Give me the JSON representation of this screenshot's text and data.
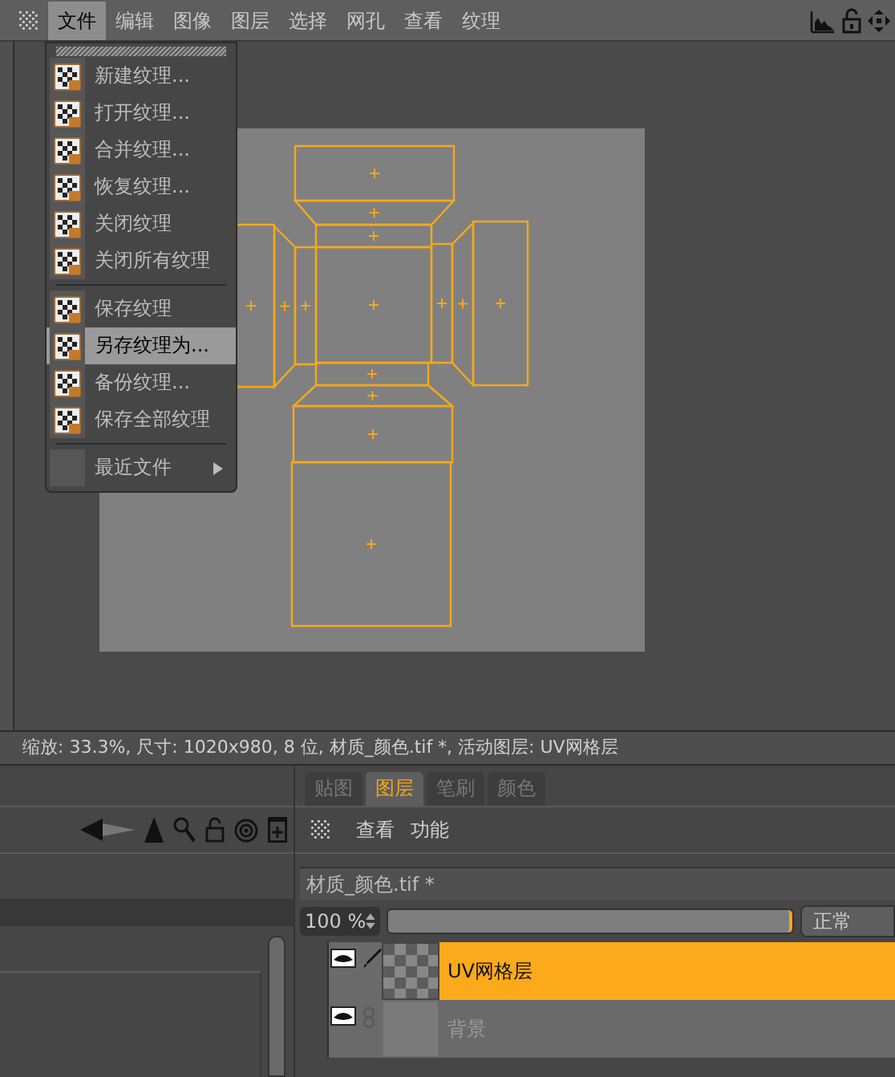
{
  "menubar": {
    "items": [
      {
        "label": "文件",
        "selected": true
      },
      {
        "label": "编辑",
        "selected": false
      },
      {
        "label": "图像",
        "selected": false
      },
      {
        "label": "图层",
        "selected": false
      },
      {
        "label": "选择",
        "selected": false
      },
      {
        "label": "网孔",
        "selected": false
      },
      {
        "label": "查看",
        "selected": false
      },
      {
        "label": "纹理",
        "selected": false
      }
    ]
  },
  "file_menu": {
    "sections": [
      [
        {
          "label": "新建纹理...",
          "kind": "item",
          "selected": false
        },
        {
          "label": "打开纹理...",
          "kind": "item",
          "selected": false
        },
        {
          "label": "合并纹理...",
          "kind": "item",
          "selected": false
        },
        {
          "label": "恢复纹理...",
          "kind": "item",
          "selected": false
        },
        {
          "label": "关闭纹理",
          "kind": "item",
          "selected": false
        },
        {
          "label": "关闭所有纹理",
          "kind": "item",
          "selected": false
        }
      ],
      [
        {
          "label": "保存纹理",
          "kind": "item",
          "selected": false
        },
        {
          "label": "另存纹理为...",
          "kind": "item",
          "selected": true
        },
        {
          "label": "备份纹理...",
          "kind": "item",
          "selected": false
        },
        {
          "label": "保存全部纹理",
          "kind": "item",
          "selected": false
        }
      ],
      [
        {
          "label": "最近文件",
          "kind": "submenu",
          "selected": false
        }
      ]
    ]
  },
  "status_bar": "缩放: 33.3%, 尺寸: 1020x980, 8 位, 材质_颜色.tif *, 活动图层: UV网格层",
  "panel_tabs": [
    {
      "label": "贴图",
      "selected": false
    },
    {
      "label": "图层",
      "selected": true
    },
    {
      "label": "笔刷",
      "selected": false
    },
    {
      "label": "颜色",
      "selected": false
    }
  ],
  "layers_panel": {
    "menu": [
      "查看",
      "功能"
    ],
    "document": "材质_颜色.tif *",
    "opacity": {
      "value": "100 %",
      "level": 1
    },
    "blend_mode": "正常",
    "layers": [
      {
        "name": "UV网格层",
        "visible": true,
        "selected": true,
        "kind": "paint"
      },
      {
        "name": "背景",
        "visible": true,
        "selected": false,
        "kind": "base"
      }
    ]
  }
}
